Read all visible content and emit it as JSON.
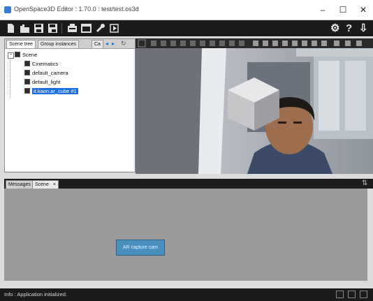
{
  "window": {
    "title": "OpenSpace3D Editor : 1.70.0 : test/test.os3d",
    "minimize_glyph": "–",
    "maximize_glyph": "☐",
    "close_glyph": "✕"
  },
  "toolbar": {
    "right_tools": [
      "⚙",
      "?",
      "⇩"
    ]
  },
  "left_panel": {
    "tabs": [
      "Scene tree",
      "Group instances",
      "Ca"
    ],
    "tree": {
      "root": "Scene",
      "items": [
        {
          "label": "Cinematics",
          "selected": false
        },
        {
          "label": "default_camera",
          "selected": false
        },
        {
          "label": "default_light",
          "selected": false
        },
        {
          "label": "it.kaon.ar_cube #1",
          "selected": true
        }
      ]
    }
  },
  "bottom_panel": {
    "tabs": [
      "Messages",
      "Scene"
    ],
    "close_glyph": "×",
    "objects": [
      {
        "label": "AR capture cam"
      }
    ]
  },
  "status": {
    "text": "Info : Application initialized."
  },
  "colors": {
    "toolbar_bg": "#1b1b1b",
    "selection": "#1e6fd9",
    "object_box": "#4b8fbf",
    "canvas_bg": "#9a9a9a"
  }
}
